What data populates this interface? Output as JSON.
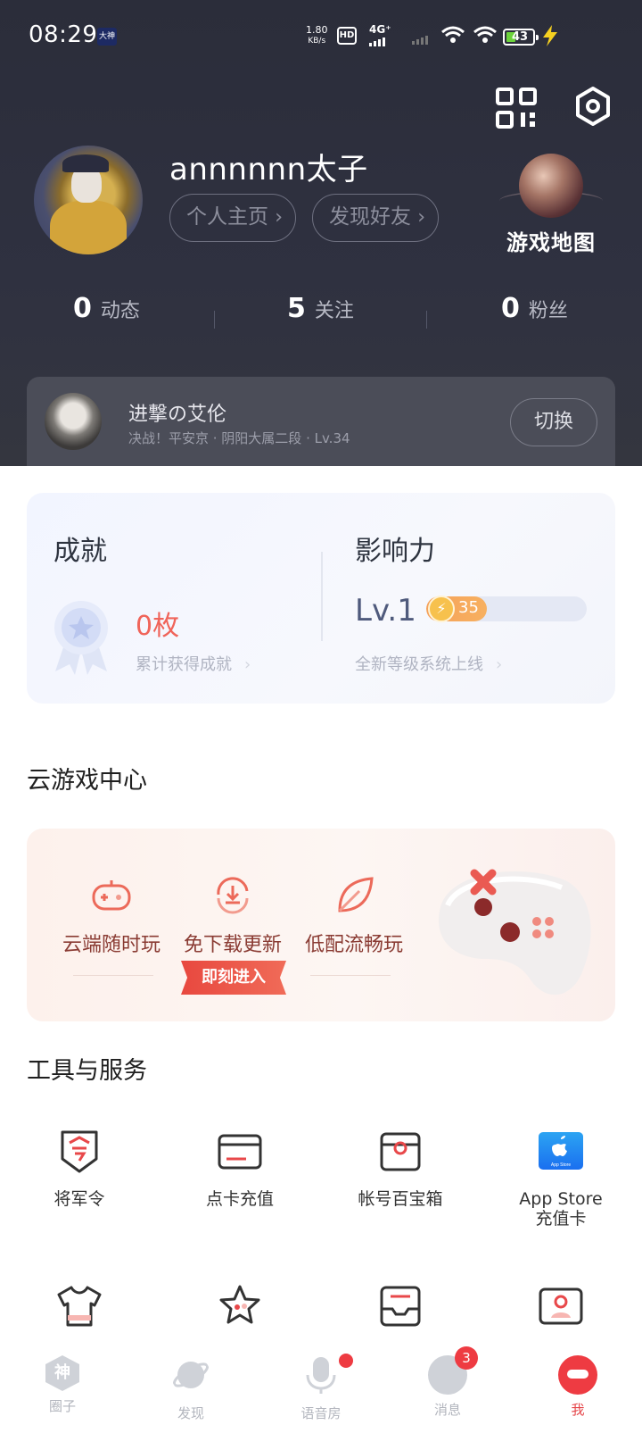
{
  "status_bar": {
    "time": "08:29",
    "app_badge": "大神",
    "net_speed_value": "1.80",
    "net_speed_unit": "KB/s",
    "hd": "HD",
    "network": "4G⁺",
    "battery": "43"
  },
  "profile": {
    "username": "annnnnn太子",
    "home_button": "个人主页",
    "find_friends_button": "发现好友",
    "game_map_label": "游戏地图"
  },
  "stats": [
    {
      "count": "0",
      "label": "动态"
    },
    {
      "count": "5",
      "label": "关注"
    },
    {
      "count": "0",
      "label": "粉丝"
    }
  ],
  "game_role": {
    "name": "进撃の艾伦",
    "desc": "决战！平安京 · 阴阳大属二段 · Lv.34",
    "switch_button": "切换"
  },
  "achievement": {
    "title": "成就",
    "count": "0枚",
    "subtitle": "累计获得成就",
    "chevron": "›"
  },
  "influence": {
    "title": "影响力",
    "level": "Lv.1",
    "points": "35",
    "progress": 0.38,
    "subtitle": "全新等级系统上线",
    "chevron": "›"
  },
  "cloud_center": {
    "title": "云游戏中心",
    "features": [
      "云端随时玩",
      "免下载更新",
      "低配流畅玩"
    ],
    "enter_button": "即刻进入"
  },
  "tools": {
    "title": "工具与服务",
    "items": [
      {
        "label": "将军令",
        "icon": "shield-icon"
      },
      {
        "label": "点卡充值",
        "icon": "card-icon"
      },
      {
        "label": "帐号百宝箱",
        "icon": "treasure-box-icon"
      },
      {
        "label": "App Store\n充值卡",
        "icon": "app-store-icon"
      },
      {
        "label": "",
        "icon": "tshirt-icon"
      },
      {
        "label": "",
        "icon": "star-icon"
      },
      {
        "label": "",
        "icon": "inbox-icon"
      },
      {
        "label": "",
        "icon": "id-card-icon"
      }
    ],
    "app_store_badge": "App Store"
  },
  "tabbar": {
    "items": [
      {
        "label": "圈子",
        "icon": "shen-icon"
      },
      {
        "label": "发现",
        "icon": "planet-icon"
      },
      {
        "label": "语音房",
        "icon": "microphone-icon"
      },
      {
        "label": "消息",
        "icon": "message-icon"
      },
      {
        "label": "我",
        "icon": "me-icon"
      }
    ],
    "message_badge": "3",
    "active": "我"
  },
  "colors": {
    "accent": "#ee3b42",
    "header_bg": "#2f3140",
    "achievement_count": "#f0645a",
    "level_fill": "#f6a25a"
  }
}
